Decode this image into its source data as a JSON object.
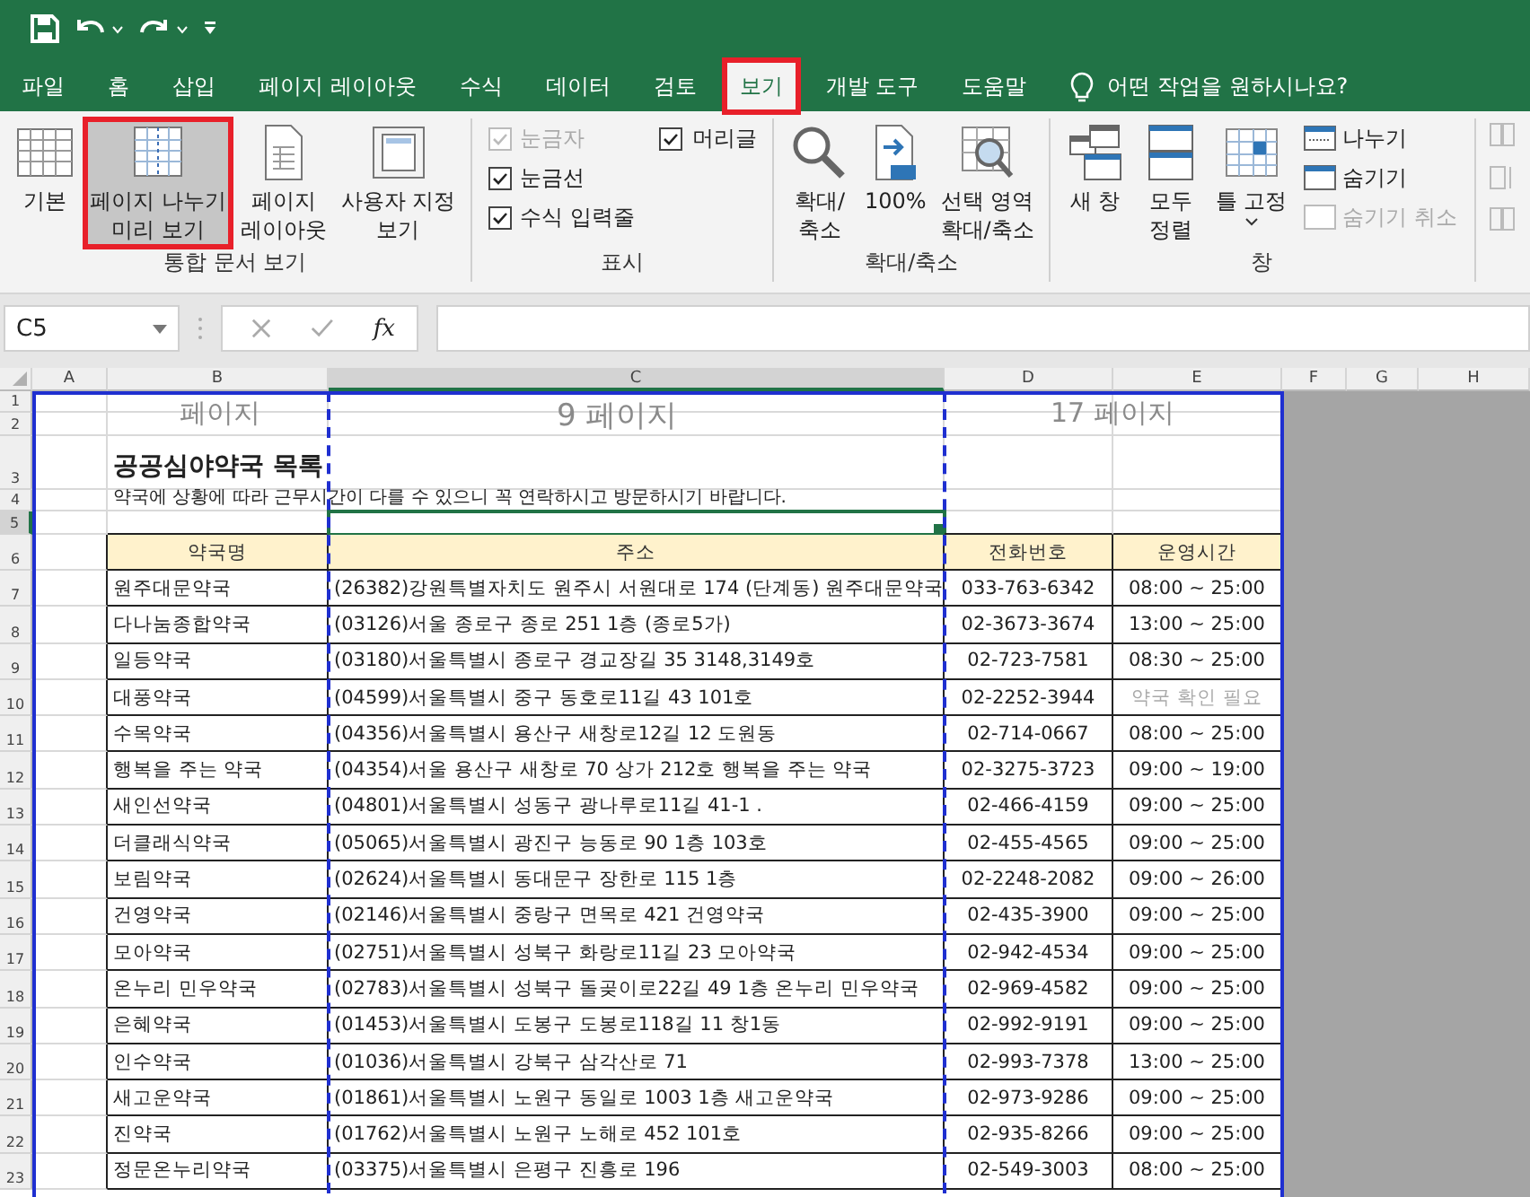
{
  "tabs": [
    {
      "label": "파일",
      "selected": false,
      "annotated": false
    },
    {
      "label": "홈",
      "selected": false,
      "annotated": false
    },
    {
      "label": "삽입",
      "selected": false,
      "annotated": false
    },
    {
      "label": "페이지 레이아웃",
      "selected": false,
      "annotated": false
    },
    {
      "label": "수식",
      "selected": false,
      "annotated": false
    },
    {
      "label": "데이터",
      "selected": false,
      "annotated": false
    },
    {
      "label": "검토",
      "selected": false,
      "annotated": false
    },
    {
      "label": "보기",
      "selected": true,
      "annotated": true
    },
    {
      "label": "개발 도구",
      "selected": false,
      "annotated": false
    },
    {
      "label": "도움말",
      "selected": false,
      "annotated": false
    }
  ],
  "tell_me": "어떤 작업을 원하시나요?",
  "ribbon_groups": [
    {
      "label": "통합 문서 보기",
      "items": [
        {
          "kind": "big",
          "label": "기본",
          "selected": false,
          "annotated": false
        },
        {
          "kind": "big",
          "label": "페이지 나누기\n미리 보기",
          "selected": true,
          "annotated": true
        },
        {
          "kind": "big",
          "label": "페이지\n레이아웃",
          "selected": false,
          "annotated": false
        },
        {
          "kind": "big",
          "label": "사용자 지정\n보기",
          "selected": false,
          "annotated": false
        }
      ]
    },
    {
      "label": "표시",
      "items": [
        {
          "kind": "check",
          "label": "눈금자",
          "checked": true,
          "disabled": true
        },
        {
          "kind": "check",
          "label": "눈금선",
          "checked": true,
          "disabled": false
        },
        {
          "kind": "check",
          "label": "수식 입력줄",
          "checked": true,
          "disabled": false
        },
        {
          "kind": "check",
          "label": "머리글",
          "checked": true,
          "disabled": false
        }
      ]
    },
    {
      "label": "확대/축소",
      "items": [
        {
          "kind": "big",
          "label": "확대/\n축소",
          "selected": false,
          "annotated": false
        },
        {
          "kind": "big",
          "label": "100%",
          "selected": false,
          "annotated": false
        },
        {
          "kind": "big",
          "label": "선택 영역\n확대/축소",
          "selected": false,
          "annotated": false
        }
      ]
    },
    {
      "label": "창",
      "items": [
        {
          "kind": "big",
          "label": "새 창",
          "selected": false,
          "annotated": false
        },
        {
          "kind": "big",
          "label": "모두\n정렬",
          "selected": false,
          "annotated": false
        },
        {
          "kind": "big",
          "label": "틀 고정",
          "selected": false,
          "annotated": false,
          "has_menu": true
        },
        {
          "kind": "small",
          "label": "나누기",
          "disabled": false
        },
        {
          "kind": "small",
          "label": "숨기기",
          "disabled": false
        },
        {
          "kind": "small",
          "label": "숨기기 취소",
          "disabled": true
        }
      ]
    }
  ],
  "formula_bar": {
    "name_box": "C5",
    "function_label": "fx"
  },
  "sheet": {
    "columns": [
      {
        "label": "A",
        "selected": false
      },
      {
        "label": "B",
        "selected": false
      },
      {
        "label": "C",
        "selected": true
      },
      {
        "label": "D",
        "selected": false
      },
      {
        "label": "E",
        "selected": false
      },
      {
        "label": "F",
        "selected": false
      },
      {
        "label": "G",
        "selected": false
      },
      {
        "label": "H",
        "selected": false
      }
    ],
    "rows": [
      {
        "label": "1",
        "selected": false
      },
      {
        "label": "2",
        "selected": false
      },
      {
        "label": "3",
        "selected": false
      },
      {
        "label": "4",
        "selected": false
      },
      {
        "label": "5",
        "selected": true
      },
      {
        "label": "6",
        "selected": false
      },
      {
        "label": "7",
        "selected": false
      },
      {
        "label": "8",
        "selected": false
      },
      {
        "label": "9",
        "selected": false
      },
      {
        "label": "10",
        "selected": false
      },
      {
        "label": "11",
        "selected": false
      },
      {
        "label": "12",
        "selected": false
      },
      {
        "label": "13",
        "selected": false
      },
      {
        "label": "14",
        "selected": false
      },
      {
        "label": "15",
        "selected": false
      },
      {
        "label": "16",
        "selected": false
      },
      {
        "label": "17",
        "selected": false
      },
      {
        "label": "18",
        "selected": false
      },
      {
        "label": "19",
        "selected": false
      },
      {
        "label": "20",
        "selected": false
      },
      {
        "label": "21",
        "selected": false
      },
      {
        "label": "22",
        "selected": false
      },
      {
        "label": "23",
        "selected": false
      }
    ],
    "title": "공공심야약국 목록",
    "note": "약국에 상황에 따라 근무시간이 다를 수 있으니 꼭 연락하시고 방문하시기 바랍니다.",
    "headers": [
      "약국명",
      "주소",
      "전화번호",
      "운영시간"
    ],
    "records": [
      {
        "name": "원주대문약국",
        "address": "(26382)강원특별자치도 원주시 서원대로 174 (단계동) 원주대문약국",
        "phone": "033-763-6342",
        "hours": "08:00 ~ 25:00",
        "hours_muted": false
      },
      {
        "name": "다나눔종합약국",
        "address": "(03126)서울 종로구 종로 251 1층 (종로5가)",
        "phone": "02-3673-3674",
        "hours": "13:00 ~ 25:00",
        "hours_muted": false
      },
      {
        "name": "일등약국",
        "address": "(03180)서울특별시 종로구 경교장길 35 3148,3149호",
        "phone": "02-723-7581",
        "hours": "08:30 ~ 25:00",
        "hours_muted": false
      },
      {
        "name": "대풍약국",
        "address": "(04599)서울특별시 중구 동호로11길 43 101호",
        "phone": "02-2252-3944",
        "hours": "약국 확인 필요",
        "hours_muted": true
      },
      {
        "name": "수목약국",
        "address": "(04356)서울특별시 용산구 새창로12길 12 도원동",
        "phone": "02-714-0667",
        "hours": "08:00 ~ 25:00",
        "hours_muted": false
      },
      {
        "name": "행복을 주는 약국",
        "address": "(04354)서울 용산구 새창로 70 상가 212호 행복을 주는 약국",
        "phone": "02-3275-3723",
        "hours": "09:00 ~ 19:00",
        "hours_muted": false
      },
      {
        "name": "새인선약국",
        "address": "(04801)서울특별시 성동구 광나루로11길 41-1 .",
        "phone": "02-466-4159",
        "hours": "09:00 ~ 25:00",
        "hours_muted": false
      },
      {
        "name": "더클래식약국",
        "address": "(05065)서울특별시 광진구 능동로 90 1층 103호",
        "phone": "02-455-4565",
        "hours": "09:00 ~ 25:00",
        "hours_muted": false
      },
      {
        "name": "보림약국",
        "address": "(02624)서울특별시 동대문구 장한로 115 1층",
        "phone": "02-2248-2082",
        "hours": "09:00 ~ 26:00",
        "hours_muted": false
      },
      {
        "name": "건영약국",
        "address": "(02146)서울특별시 중랑구 면목로 421 건영약국",
        "phone": "02-435-3900",
        "hours": "09:00 ~ 25:00",
        "hours_muted": false
      },
      {
        "name": "모아약국",
        "address": "(02751)서울특별시 성북구 화랑로11길 23 모아약국",
        "phone": "02-942-4534",
        "hours": "09:00 ~ 25:00",
        "hours_muted": false
      },
      {
        "name": "온누리 민우약국",
        "address": "(02783)서울특별시 성북구 돌곶이로22길 49 1층 온누리 민우약국",
        "phone": "02-969-4582",
        "hours": "09:00 ~ 25:00",
        "hours_muted": false
      },
      {
        "name": "은혜약국",
        "address": "(01453)서울특별시 도봉구 도봉로118길 11 창1동",
        "phone": "02-992-9191",
        "hours": "09:00 ~ 25:00",
        "hours_muted": false
      },
      {
        "name": "인수약국",
        "address": "(01036)서울특별시 강북구 삼각산로 71",
        "phone": "02-993-7378",
        "hours": "13:00 ~ 25:00",
        "hours_muted": false
      },
      {
        "name": "새고운약국",
        "address": "(01861)서울특별시 노원구 동일로 1003 1층 새고운약국",
        "phone": "02-973-9286",
        "hours": "09:00 ~ 25:00",
        "hours_muted": false
      },
      {
        "name": "진약국",
        "address": "(01762)서울특별시 노원구 노해로 452 101호",
        "phone": "02-935-8266",
        "hours": "09:00 ~ 25:00",
        "hours_muted": false
      },
      {
        "name": "정문온누리약국",
        "address": "(03375)서울특별시 은평구 진흥로 196",
        "phone": "02-549-3003",
        "hours": "08:00 ~ 25:00",
        "hours_muted": false
      }
    ],
    "page_labels": [
      "페이지",
      "9 페이지",
      "17 페이지"
    ]
  }
}
